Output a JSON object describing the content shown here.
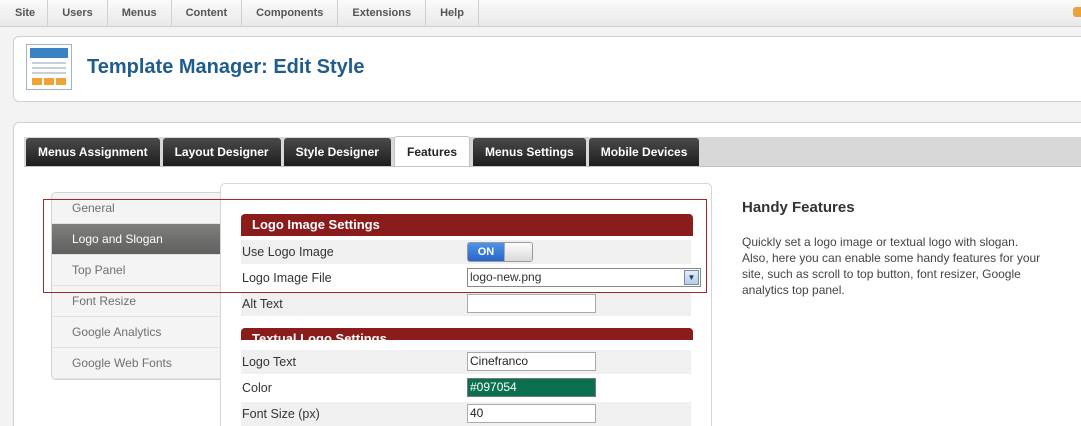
{
  "menubar": {
    "items": [
      "Site",
      "Users",
      "Menus",
      "Content",
      "Components",
      "Extensions",
      "Help"
    ]
  },
  "header": {
    "title": "Template Manager: Edit Style",
    "icon": "template-manager-icon"
  },
  "tabs": [
    {
      "label": "Menus Assignment",
      "active": false
    },
    {
      "label": "Layout Designer",
      "active": false
    },
    {
      "label": "Style Designer",
      "active": false
    },
    {
      "label": "Features",
      "active": true
    },
    {
      "label": "Menus Settings",
      "active": false
    },
    {
      "label": "Mobile Devices",
      "active": false
    }
  ],
  "sidenav": {
    "items": [
      {
        "label": "General",
        "active": false
      },
      {
        "label": "Logo and Slogan",
        "active": true
      },
      {
        "label": "Top Panel",
        "active": false
      },
      {
        "label": "Font Resize",
        "active": false
      },
      {
        "label": "Google Analytics",
        "active": false
      },
      {
        "label": "Google Web Fonts",
        "active": false
      }
    ]
  },
  "form": {
    "logo_section": {
      "heading": "Logo Image Settings",
      "use_logo_label": "Use Logo Image",
      "use_logo_toggle": "ON",
      "logo_file_label": "Logo Image File",
      "logo_file_value": "logo-new.png",
      "alt_text_label": "Alt Text",
      "alt_text_value": ""
    },
    "textual_section": {
      "heading": "Textual Logo Settings",
      "logo_text_label": "Logo Text",
      "logo_text_value": "Cinefranco",
      "color_label": "Color",
      "color_value": "#097054",
      "font_size_label": "Font Size (px)",
      "font_size_value": "40"
    }
  },
  "info": {
    "title": "Handy Features",
    "text": "Quickly set a logo image or textual logo with slogan. Also, here you can enable some handy features for your site, such as scroll to top button, font resizer, Google analytics top panel."
  },
  "colors": {
    "section_header": "#8b1c1c",
    "title_blue": "#1f5d8f",
    "highlight_border": "#a02828",
    "toggle_on": "#2a64c8",
    "color_swatch": "#097054"
  }
}
